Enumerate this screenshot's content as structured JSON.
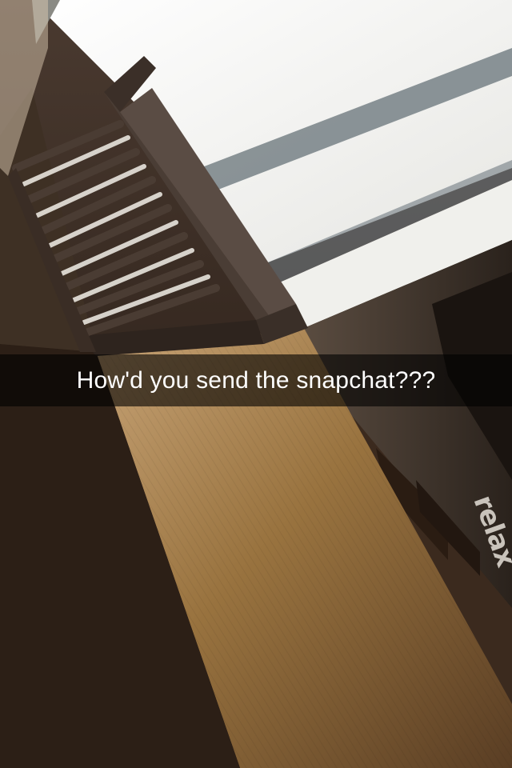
{
  "snap": {
    "caption": "How'd you send the snapchat???",
    "wall_decal_text": "relax"
  },
  "colors": {
    "caption_bar": "#000000",
    "caption_text": "#ffffff",
    "window_light": "#f4f4f2",
    "wood_floor": "#8a6740",
    "dark_wall": "#2a1d14",
    "chair_wood": "#4a3a30"
  },
  "icons": {
    "window": "window-shape",
    "chair": "chair-shape"
  }
}
